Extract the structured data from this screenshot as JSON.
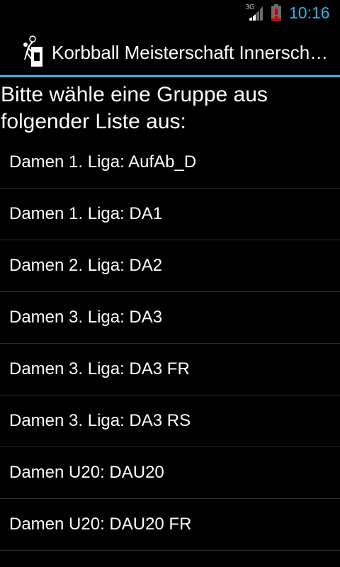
{
  "status_bar": {
    "network_type": "3G",
    "time": "10:16",
    "battery_alert": "!",
    "colors": {
      "time": "#33b5e5",
      "battery_alert": "#cc0000"
    }
  },
  "action_bar": {
    "title": "Korbball Meisterschaft Innerschweiz",
    "icon": "basketball-player-icon",
    "accent_color": "#33b5e5"
  },
  "main": {
    "prompt": "Bitte wähle eine Gruppe aus folgender Liste aus:",
    "groups": [
      "Damen 1. Liga: AufAb_D",
      "Damen 1. Liga: DA1",
      "Damen 2. Liga: DA2",
      "Damen 3. Liga: DA3",
      "Damen 3. Liga: DA3 FR",
      "Damen 3. Liga: DA3 RS",
      "Damen U20: DAU20",
      "Damen U20: DAU20 FR"
    ]
  }
}
